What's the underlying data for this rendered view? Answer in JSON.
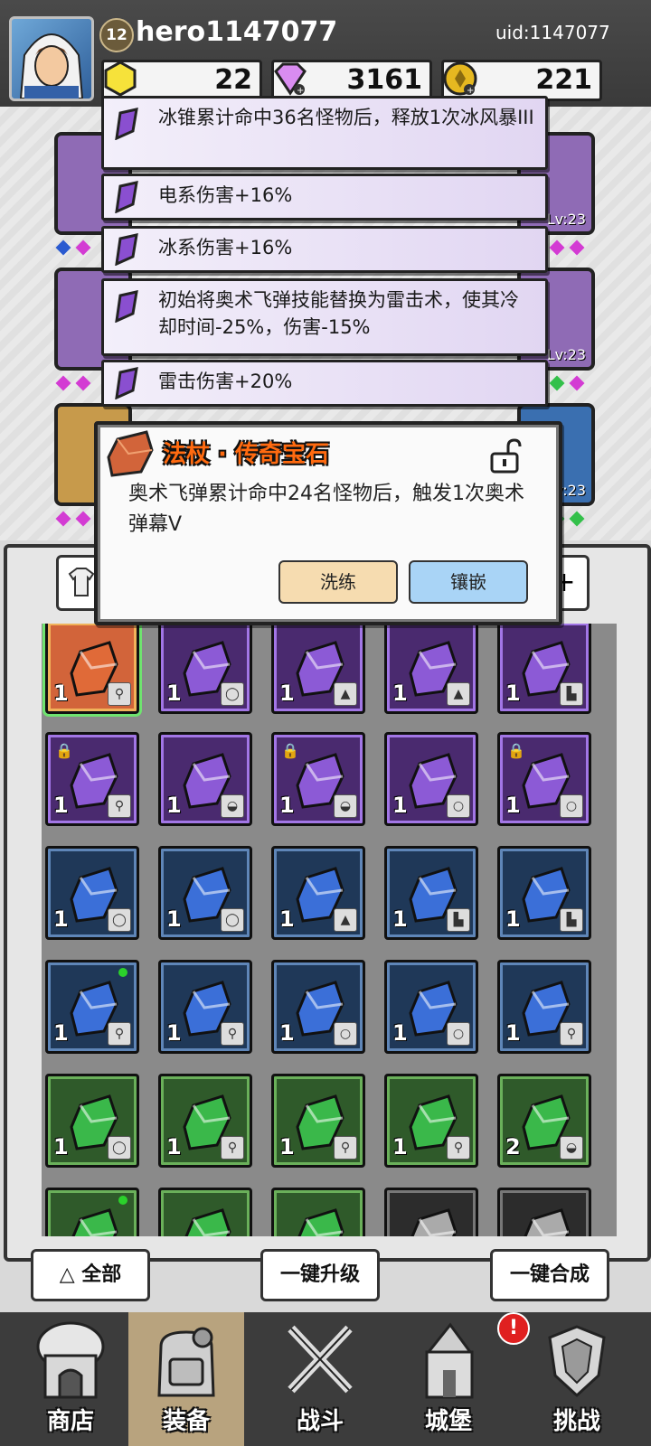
{
  "header": {
    "level": "12",
    "username": "hero1147077",
    "uid": "uid:1147077",
    "currencies": [
      {
        "icon": "gold-hexagon-icon",
        "value": "22"
      },
      {
        "icon": "purple-diamond-icon",
        "value": "3161"
      },
      {
        "icon": "gold-coin-icon",
        "value": "221"
      }
    ]
  },
  "equipment_slots": [
    {
      "level": "Lv:23"
    },
    {
      "level": "Lv:23"
    },
    {
      "level": "Lv:23"
    }
  ],
  "stat_lines": [
    {
      "text": "冰锥累计命中36名怪物后，释放1次冰风暴III"
    },
    {
      "text": "电系伤害+16%"
    },
    {
      "text": "冰系伤害+16%"
    },
    {
      "text": "初始将奥术飞弹技能替换为雷击术，使其冷却时间-25%，伤害-15%"
    },
    {
      "text": "雷击伤害+20%"
    }
  ],
  "popup": {
    "title": "法杖 · 传奇宝石",
    "description": "奥术飞弹累计命中24名怪物后，触发1次奥术弹幕V",
    "reforge_label": "洗练",
    "inlay_label": "镶嵌"
  },
  "inventory": {
    "rows": [
      [
        {
          "rarity": "orange",
          "qty": "1",
          "slot": "staff",
          "selected": true
        },
        {
          "rarity": "purple",
          "qty": "1",
          "slot": "ring"
        },
        {
          "rarity": "purple",
          "qty": "1",
          "slot": "armor"
        },
        {
          "rarity": "purple",
          "qty": "1",
          "slot": "armor"
        },
        {
          "rarity": "purple",
          "qty": "1",
          "slot": "boots"
        }
      ],
      [
        {
          "rarity": "purple",
          "qty": "1",
          "slot": "staff",
          "locked": true
        },
        {
          "rarity": "purple",
          "qty": "1",
          "slot": "hat"
        },
        {
          "rarity": "purple",
          "qty": "1",
          "slot": "hat",
          "locked": true
        },
        {
          "rarity": "purple",
          "qty": "1",
          "slot": "necklace"
        },
        {
          "rarity": "purple",
          "qty": "1",
          "slot": "necklace",
          "locked": true
        }
      ],
      [
        {
          "rarity": "blue",
          "qty": "1",
          "slot": "ring"
        },
        {
          "rarity": "blue",
          "qty": "1",
          "slot": "ring"
        },
        {
          "rarity": "blue",
          "qty": "1",
          "slot": "armor"
        },
        {
          "rarity": "blue",
          "qty": "1",
          "slot": "boots"
        },
        {
          "rarity": "blue",
          "qty": "1",
          "slot": "boots"
        }
      ],
      [
        {
          "rarity": "blue",
          "qty": "1",
          "slot": "staff",
          "new": true
        },
        {
          "rarity": "blue",
          "qty": "1",
          "slot": "staff"
        },
        {
          "rarity": "blue",
          "qty": "1",
          "slot": "necklace"
        },
        {
          "rarity": "blue",
          "qty": "1",
          "slot": "necklace"
        },
        {
          "rarity": "blue",
          "qty": "1",
          "slot": "staff"
        }
      ],
      [
        {
          "rarity": "green",
          "qty": "1",
          "slot": "ring"
        },
        {
          "rarity": "green",
          "qty": "1",
          "slot": "staff"
        },
        {
          "rarity": "green",
          "qty": "1",
          "slot": "staff"
        },
        {
          "rarity": "green",
          "qty": "1",
          "slot": "staff"
        },
        {
          "rarity": "green",
          "qty": "2",
          "slot": "hat"
        }
      ]
    ],
    "peek_row": [
      {
        "rarity": "green",
        "new": true
      },
      {
        "rarity": "green"
      },
      {
        "rarity": "green"
      },
      {
        "rarity": "gray"
      },
      {
        "rarity": "gray"
      }
    ]
  },
  "actions": {
    "filter_label": "全部",
    "upgrade_label": "一键升级",
    "merge_label": "一键合成"
  },
  "nav": [
    {
      "label": "商店",
      "icon": "shop-icon"
    },
    {
      "label": "装备",
      "icon": "backpack-icon",
      "active": true
    },
    {
      "label": "战斗",
      "icon": "crossed-swords-icon"
    },
    {
      "label": "城堡",
      "icon": "castle-icon",
      "alert": "!"
    },
    {
      "label": "挑战",
      "icon": "shield-crest-icon"
    }
  ],
  "colors": {
    "orange": "#d2643a",
    "purple": "#4a2a6f",
    "blue": "#1f3858",
    "green": "#2f5a2a",
    "gray": "#2c2c2c",
    "accent_title": "#ff6a10"
  }
}
